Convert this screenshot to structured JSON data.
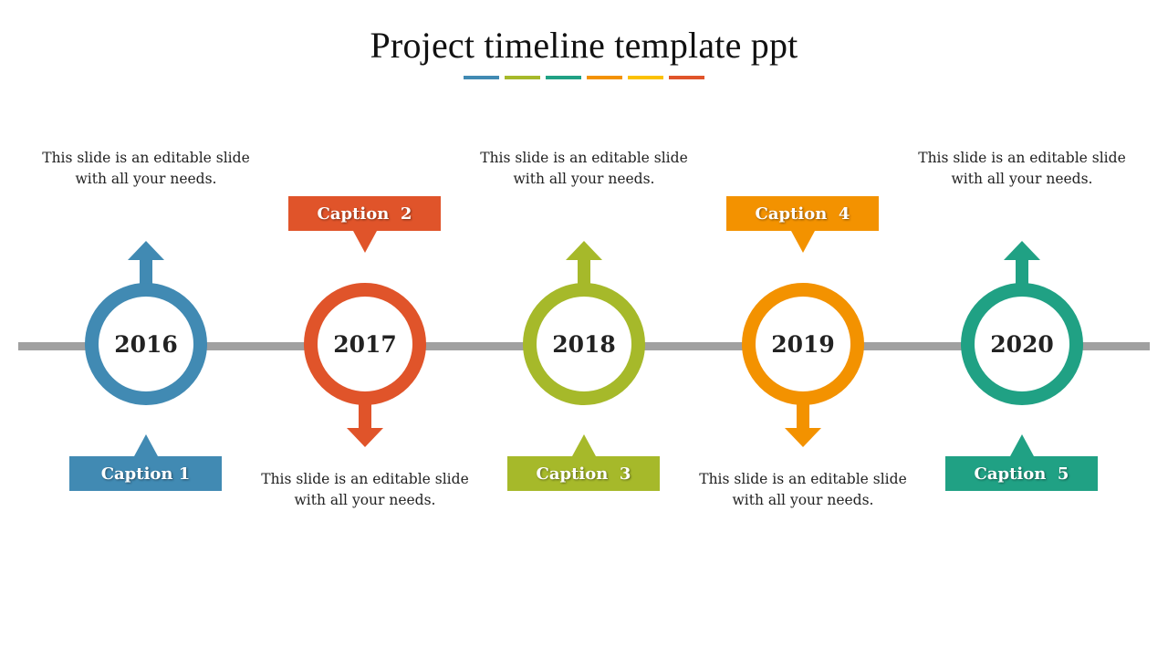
{
  "title": "Project timeline template ppt",
  "underline_colors": [
    "#418ab3",
    "#a6b92a",
    "#20a184",
    "#f39200",
    "#fbc100",
    "#e0542a"
  ],
  "timeline_color": "#a0a0a0",
  "milestones": [
    {
      "year": "2016",
      "color": "#418ab3",
      "caption": "Caption 1",
      "description": "This slide is an editable slide with all your needs.",
      "arrow_direction": "up",
      "description_position": "top",
      "caption_position": "bottom"
    },
    {
      "year": "2017",
      "color": "#e0542a",
      "caption": "Caption  2",
      "description": "This slide is an editable slide with all your needs.",
      "arrow_direction": "down",
      "description_position": "bottom",
      "caption_position": "top"
    },
    {
      "year": "2018",
      "color": "#a6b92a",
      "caption": "Caption  3",
      "description": "This slide is an editable slide with all your needs.",
      "arrow_direction": "up",
      "description_position": "top",
      "caption_position": "bottom"
    },
    {
      "year": "2019",
      "color": "#f39200",
      "caption": "Caption  4",
      "description": "This slide is an editable slide with all your needs.",
      "arrow_direction": "down",
      "description_position": "bottom",
      "caption_position": "top"
    },
    {
      "year": "2020",
      "color": "#20a184",
      "caption": "Caption  5",
      "description": "This slide is an editable slide with all your needs.",
      "arrow_direction": "up",
      "description_position": "top",
      "caption_position": "bottom"
    }
  ]
}
